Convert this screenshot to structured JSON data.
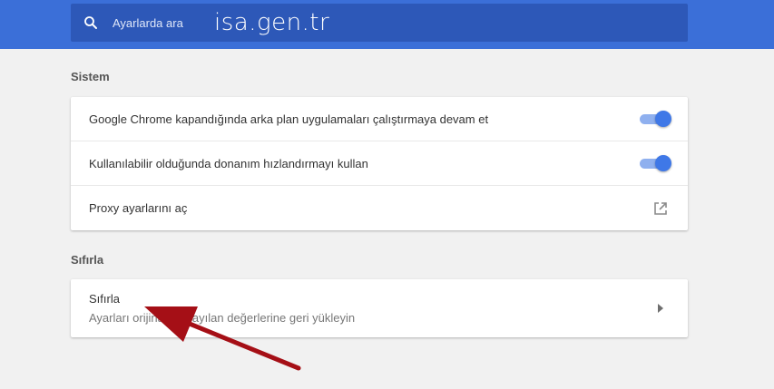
{
  "header": {
    "search_placeholder": "Ayarlarda ara",
    "watermark": "isa.gen.tr"
  },
  "sections": {
    "system": {
      "title": "Sistem",
      "rows": [
        {
          "label": "Google Chrome kapandığında arka plan uygulamaları çalıştırmaya devam et",
          "toggle_on": true
        },
        {
          "label": "Kullanılabilir olduğunda donanım hızlandırmayı kullan",
          "toggle_on": true
        },
        {
          "label": "Proxy ayarlarını aç",
          "icon": "open-in-new-icon"
        }
      ]
    },
    "reset": {
      "title": "Sıfırla",
      "row": {
        "title": "Sıfırla",
        "subtitle": "Ayarları orijinal varsayılan değerlerine geri yükleyin",
        "icon": "chevron-right-icon"
      }
    }
  },
  "colors": {
    "header_bg": "#3b6fd8",
    "search_bg": "#2d58b8",
    "toggle_on": "#3f78e7",
    "annotation_arrow": "#a50f16"
  }
}
